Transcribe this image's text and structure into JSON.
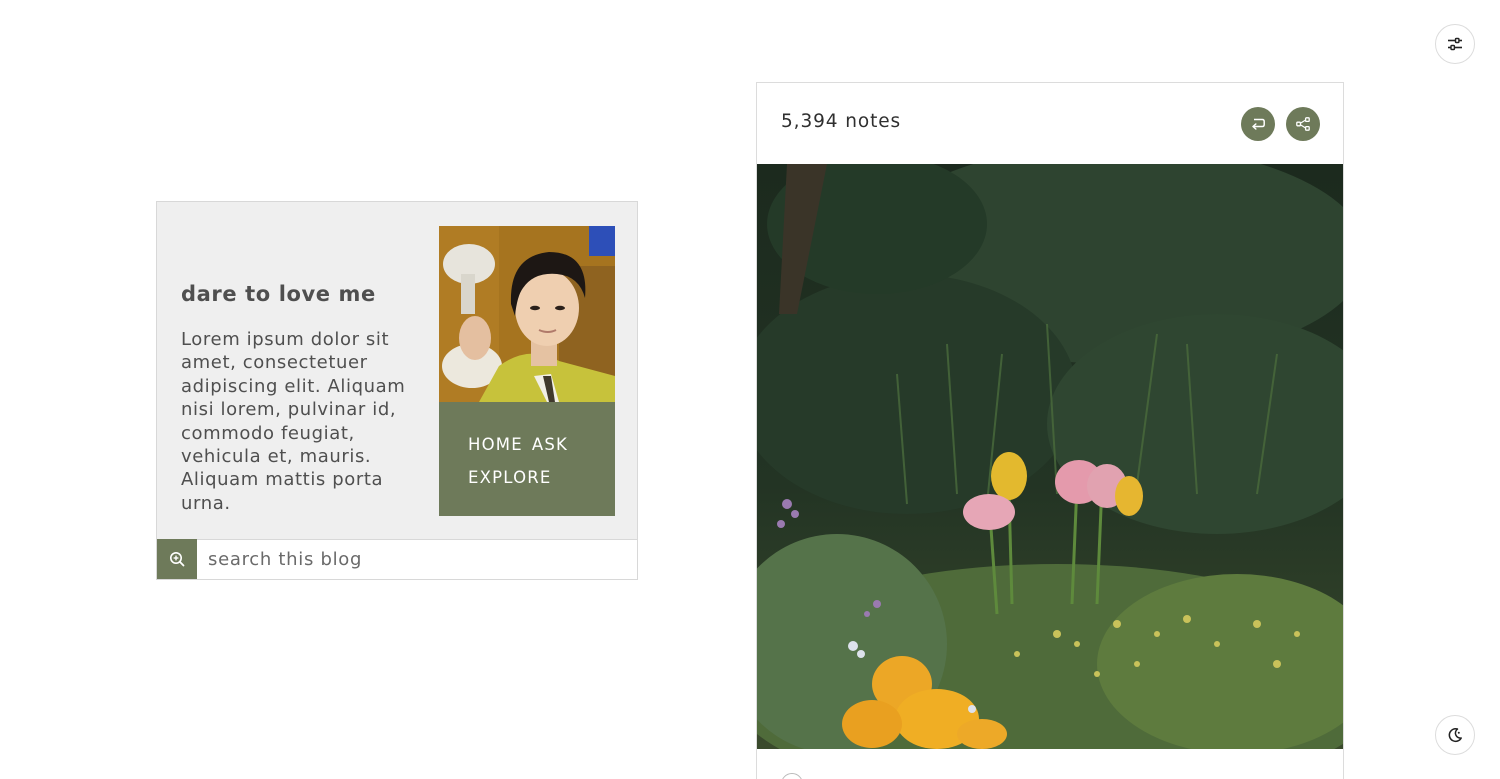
{
  "sidebar": {
    "title": "dare to love me",
    "description": "Lorem ipsum dolor sit amet, consectetuer adipiscing elit. Aliquam nisi lorem, pulvinar id, commodo feugiat, vehicula et, mauris. Aliquam mattis porta urna.",
    "nav": {
      "home": "HOME",
      "ask": "ASK",
      "explore": "EXPLORE"
    },
    "search": {
      "placeholder": "search this blog",
      "icon": "zoom-in-icon"
    },
    "avatar_icon": "avatar"
  },
  "post": {
    "notes": "5,394 notes",
    "reblog_icon": "reblog-icon",
    "share_icon": "share-icon"
  },
  "corner": {
    "top_icon": "sliders-icon",
    "bottom_icon": "moon-icon"
  },
  "colors": {
    "accent": "#6e7a5a",
    "panel": "#efefef",
    "text": "#4f4f4f"
  }
}
